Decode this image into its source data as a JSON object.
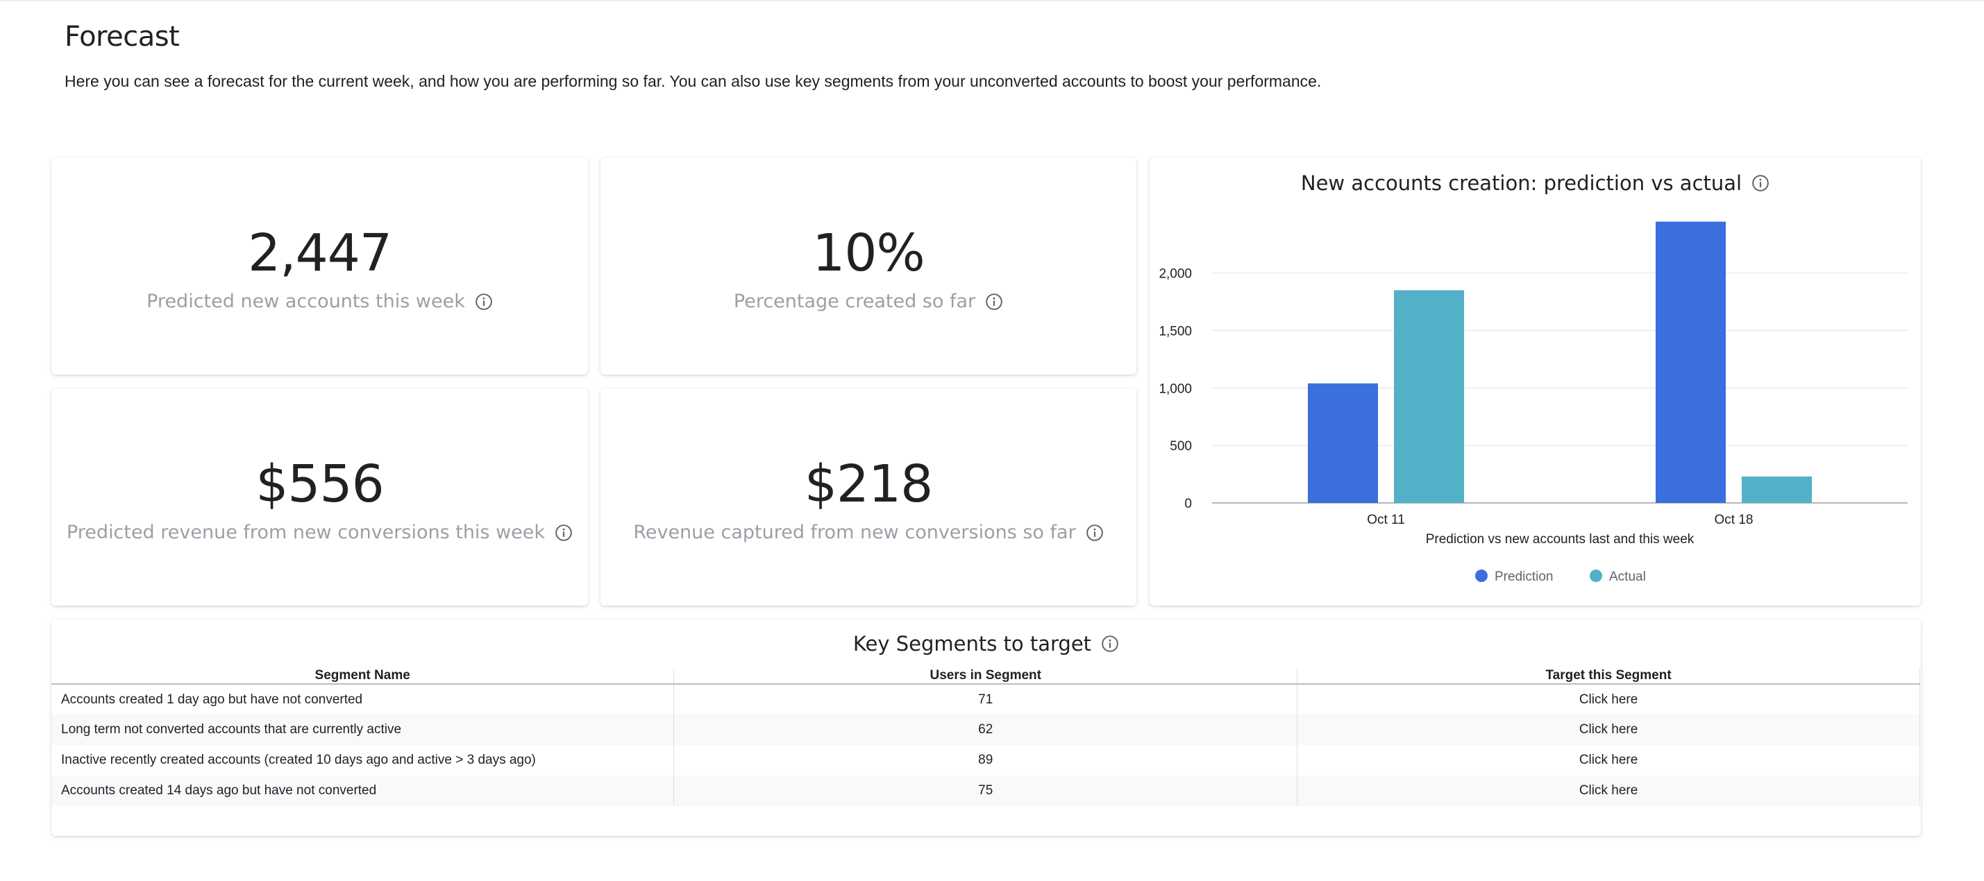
{
  "header": {
    "title": "Forecast",
    "description": "Here you can see a forecast for the current week, and how you are performing so far. You can also use key segments from your unconverted accounts to boost your performance."
  },
  "kpis": [
    {
      "value": "2,447",
      "label": "Predicted new accounts this week"
    },
    {
      "value": "10%",
      "label": "Percentage created so far"
    },
    {
      "value": "$556",
      "label": "Predicted revenue from new conversions this week"
    },
    {
      "value": "$218",
      "label": "Revenue captured from new conversions so far"
    }
  ],
  "chart_data": {
    "type": "bar",
    "title": "New accounts creation: prediction vs actual",
    "xlabel": "Prediction vs new accounts last and this week",
    "ylabel": "",
    "categories": [
      "Oct 11",
      "Oct 18"
    ],
    "series": [
      {
        "name": "Prediction",
        "values": [
          1040,
          2447
        ],
        "color": "#3a6fdc"
      },
      {
        "name": "Actual",
        "values": [
          1850,
          230
        ],
        "color": "#52b1c7"
      }
    ],
    "ylim": [
      0,
      2450
    ],
    "yticks": [
      0,
      500,
      1000,
      1500,
      2000
    ],
    "ytick_labels": [
      "0",
      "500",
      "1,000",
      "1,500",
      "2,000"
    ],
    "grid": true,
    "legend": "bottom-center"
  },
  "segments": {
    "title": "Key Segments to target",
    "columns": [
      "Segment Name",
      "Users in Segment",
      "Target this Segment"
    ],
    "rows": [
      {
        "name": "Accounts created 1 day ago but have not converted",
        "users": "71",
        "action": "Click here"
      },
      {
        "name": "Long term not converted accounts that are currently active",
        "users": "62",
        "action": "Click here"
      },
      {
        "name": "Inactive recently created accounts (created 10 days ago and active > 3 days ago)",
        "users": "89",
        "action": "Click here"
      },
      {
        "name": "Accounts created 14 days ago but have not converted",
        "users": "75",
        "action": "Click here"
      }
    ]
  },
  "icons": {
    "info": "info-circle-icon"
  }
}
